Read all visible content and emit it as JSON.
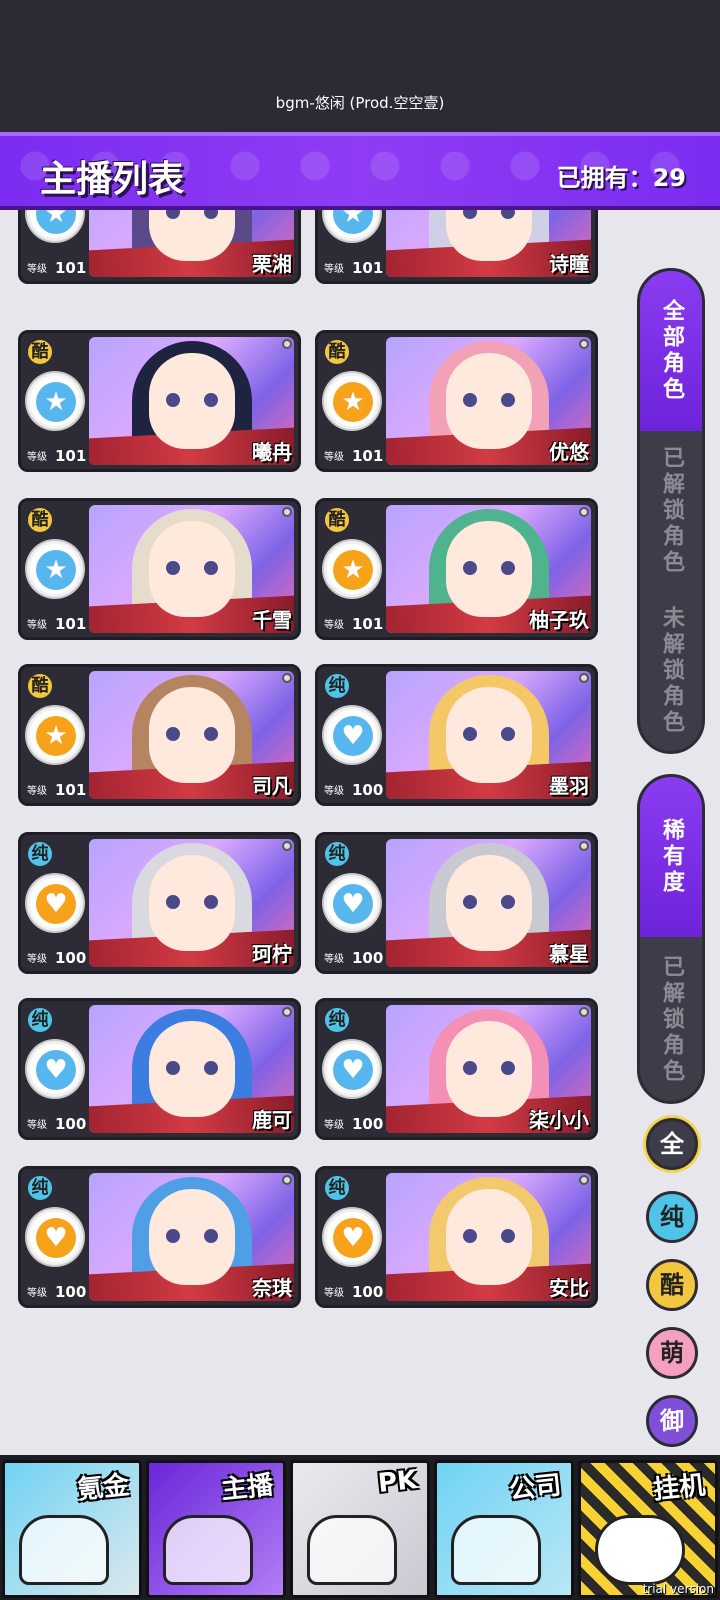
{
  "bgm": "bgm-悠闲 (Prod.空空壹)",
  "header": {
    "title": "主播列表",
    "owned": "已拥有：29"
  },
  "level_label": "等级",
  "cards": [
    {
      "name": "栗湘",
      "level": "101",
      "attr": "",
      "rank_color": "blue"
    },
    {
      "name": "诗瞳",
      "level": "101",
      "attr": "",
      "rank_color": "blue"
    },
    {
      "name": "曦冉",
      "level": "101",
      "attr": "酷",
      "rank_color": "blue"
    },
    {
      "name": "优悠",
      "level": "101",
      "attr": "酷",
      "rank_color": "orange"
    },
    {
      "name": "千雪",
      "level": "101",
      "attr": "酷",
      "rank_color": "blue"
    },
    {
      "name": "柚子玖",
      "level": "101",
      "attr": "酷",
      "rank_color": "orange"
    },
    {
      "name": "司凡",
      "level": "101",
      "attr": "酷",
      "rank_color": "orange"
    },
    {
      "name": "墨羽",
      "level": "100",
      "attr": "纯",
      "rank_color": "blue"
    },
    {
      "name": "珂柠",
      "level": "100",
      "attr": "纯",
      "rank_color": "orange"
    },
    {
      "name": "慕星",
      "level": "100",
      "attr": "纯",
      "rank_color": "blue"
    },
    {
      "name": "鹿可",
      "level": "100",
      "attr": "纯",
      "rank_color": "blue"
    },
    {
      "name": "柒小小",
      "level": "100",
      "attr": "纯",
      "rank_color": "blue"
    },
    {
      "name": "奈琪",
      "level": "100",
      "attr": "纯",
      "rank_color": "orange"
    },
    {
      "name": "安比",
      "level": "100",
      "attr": "纯",
      "rank_color": "orange"
    }
  ],
  "filter": {
    "all": "全部角色",
    "unlocked": "已解锁角色",
    "locked": "未解锁角色",
    "rarity": "稀有度",
    "rarity_unlocked": "已解锁角色"
  },
  "rarity_buttons": {
    "all": "全",
    "pure": "纯",
    "cool": "酷",
    "cute": "萌",
    "royal": "御"
  },
  "nav": {
    "b1": "氪金",
    "b2": "主播",
    "b3": "PK",
    "b4": "公司",
    "b5": "挂机"
  },
  "trial": "trial version",
  "colors": {
    "accent": "#7b2cf0",
    "cool": "#f3c63f",
    "pure": "#4fc3e8"
  }
}
